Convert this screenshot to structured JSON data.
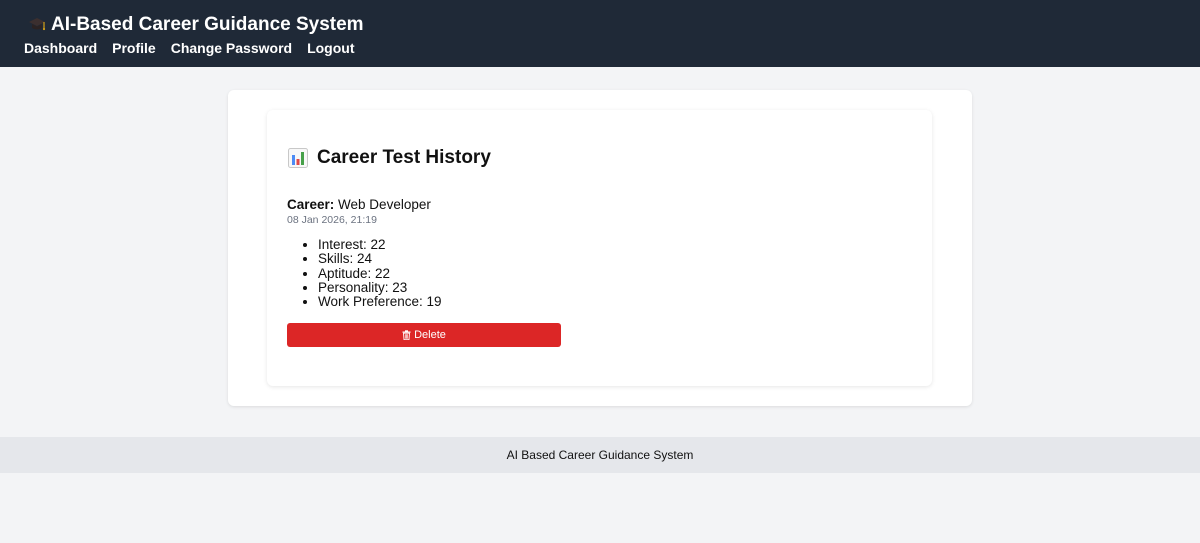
{
  "header": {
    "app_title": "AI-Based Career Guidance System",
    "brand_icon": "graduation-cap-icon",
    "nav": [
      {
        "label": "Dashboard"
      },
      {
        "label": "Profile"
      },
      {
        "label": "Change Password"
      },
      {
        "label": "Logout"
      }
    ]
  },
  "main": {
    "title_icon": "bar-chart-icon",
    "page_title": "Career Test History",
    "entry": {
      "career_label": "Career:",
      "career_value": "Web Developer",
      "timestamp": "08 Jan 2026, 21:19",
      "scores": [
        "Interest: 22",
        "Skills: 24",
        "Aptitude: 22",
        "Personality: 23",
        "Work Preference: 19"
      ],
      "delete_label": "Delete",
      "delete_icon": "trash-icon"
    }
  },
  "footer": {
    "text": "AI Based Career Guidance System"
  },
  "colors": {
    "navbar_bg": "#1f2937",
    "page_bg": "#f3f4f6",
    "delete_button": "#dc2626",
    "footer_bg": "#e5e7eb",
    "timestamp_text": "#6b7280"
  }
}
